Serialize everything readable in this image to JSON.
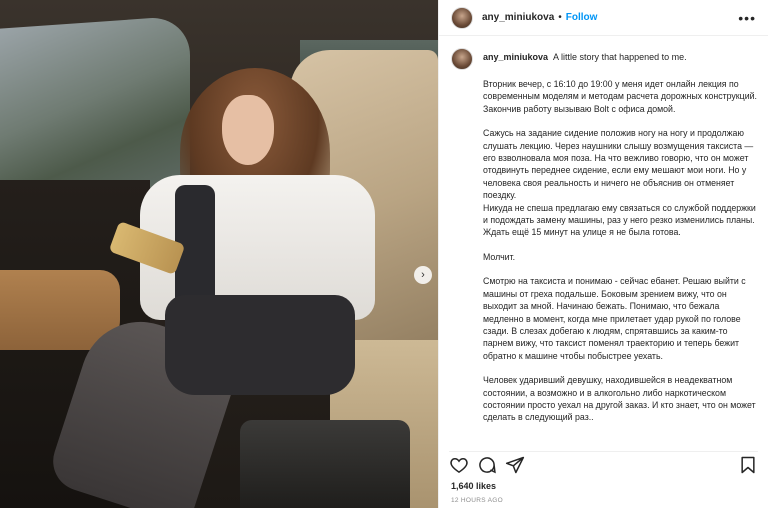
{
  "post": {
    "username": "any_miniukova",
    "follow_label": "Follow",
    "more_label": "•••",
    "next_label": "›"
  },
  "caption": {
    "username": "any_miniukova",
    "intro": "A little story that happened to me.",
    "paragraphs": [
      "Вторник вечер, с 16:10 до 19:00 у меня идет онлайн лекция по современным моделям и методам расчета дорожных конструкций. Закончив работу вызываю Bolt с офиса домой.",
      "Сажусь на задание сидение положив ногу на ногу и продолжаю слушать лекцию. Через наушники слышу возмущения таксиста — его взволновала моя поза. На что вежливо говорю, что он может отодвинуть переднее сидение, если ему мешают мои ноги. Но у человека своя реальность и ничего не объяснив он отменяет поездку.\nНикуда не спеша предлагаю ему связаться со службой поддержки и подождать замену машины, раз у него резко изменились планы. Ждать ещё 15 минут на улице я не была готова.",
      "Молчит.",
      "Смотрю на таксиста и понимаю - сейчас ебанет. Решаю выйти с машины от греха подальше. Боковым зрением вижу, что он выходит за мной. Начинаю бежать. Понимаю, что бежала медленно в момент, когда мне прилетает удар рукой по голове сзади. В слезах добегаю к людям, спрятавшись за каким-то парнем вижу, что таксист поменял траекторию и теперь бежит обратно к машине чтобы побыстрее уехать.",
      "Человек ударивший девушку, находившейся в неадекватном состоянии, а возможно и в алкогольно либо наркотическом состоянии просто уехал на другой заказ. И кто знает, что он может сделать в следующий раз.."
    ]
  },
  "stats": {
    "likes": "1,640 likes",
    "time": "12 HOURS AGO"
  },
  "icons": {
    "like": "heart-icon",
    "comment": "comment-icon",
    "share": "share-icon",
    "save": "bookmark-icon"
  },
  "colors": {
    "accent": "#0095f6",
    "text": "#262626",
    "muted": "#8e8e8e"
  }
}
